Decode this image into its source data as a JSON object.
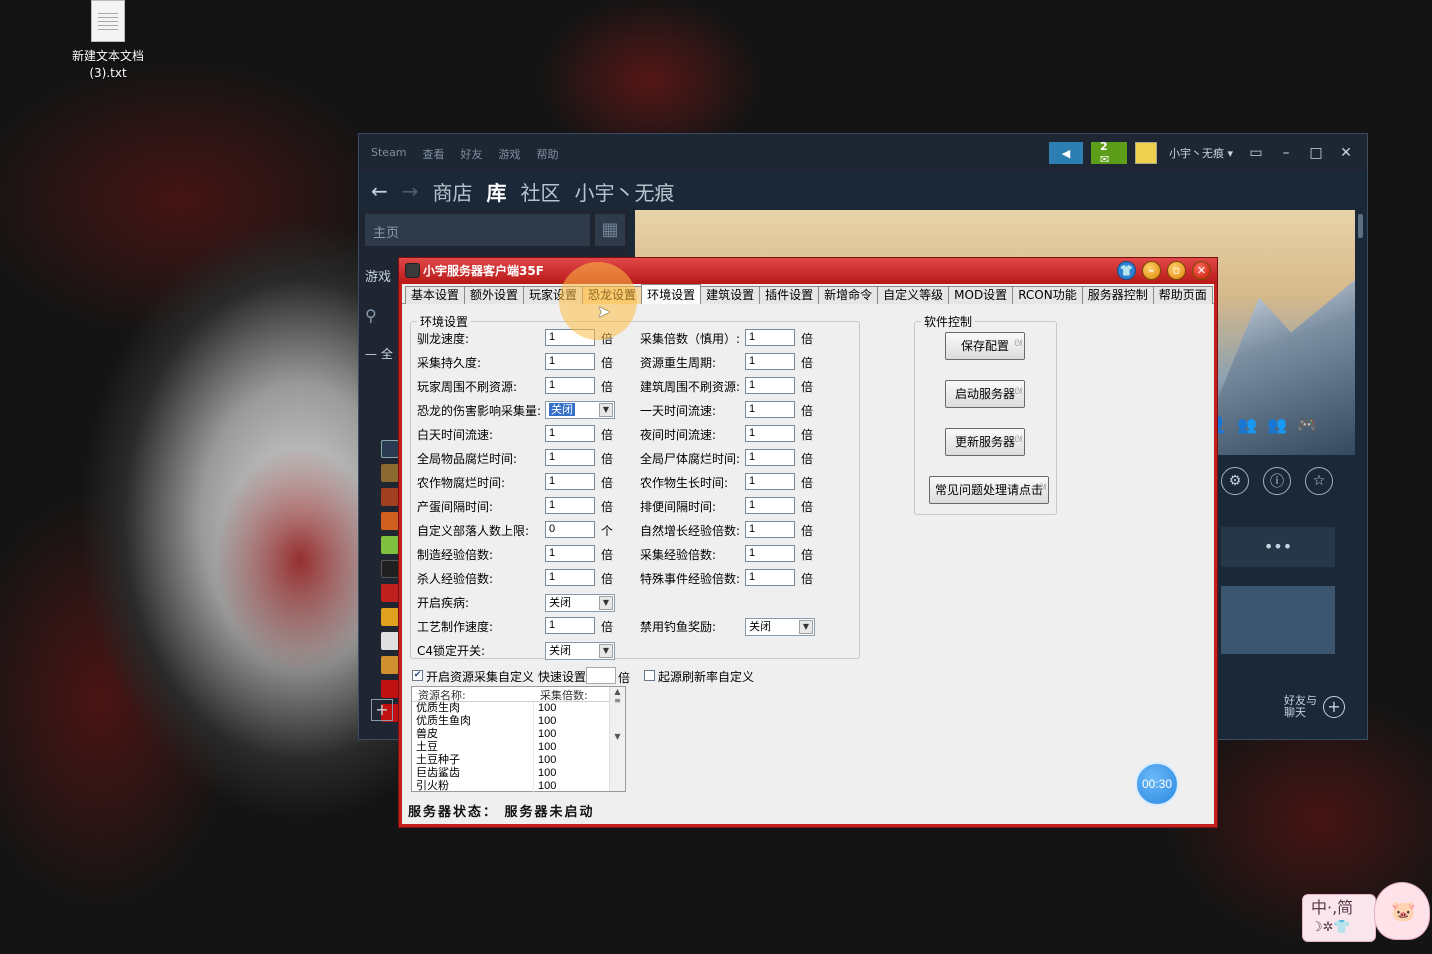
{
  "desktop": {
    "file_icon_label_1": "新建文本文档",
    "file_icon_label_2": "(3).txt"
  },
  "steam": {
    "menu": [
      "Steam",
      "查看",
      "好友",
      "游戏",
      "帮助"
    ],
    "notif_count": "2 ✉",
    "username": "小宇丶无痕 ▾",
    "nav": [
      "商店",
      "库",
      "社区",
      "小宇丶无痕"
    ],
    "sidebar_home": "主页",
    "sidebar_games": "游戏",
    "sidebar_all": "全",
    "chat_label_1": "好友与",
    "chat_label_2": "聊天",
    "more": "•••"
  },
  "app": {
    "title": "小宇服务器客户端35F",
    "tabs": [
      "基本设置",
      "额外设置",
      "玩家设置",
      "恐龙设置",
      "环境设置",
      "建筑设置",
      "插件设置",
      "新增命令",
      "自定义等级",
      "MOD设置",
      "RCON功能",
      "服务器控制",
      "帮助页面"
    ],
    "env_legend": "环境设置",
    "left_fields": [
      {
        "label": "驯龙速度:",
        "value": "1",
        "unit": "倍"
      },
      {
        "label": "采集持久度:",
        "value": "1",
        "unit": "倍"
      },
      {
        "label": "玩家周围不刷资源:",
        "value": "1",
        "unit": "倍"
      },
      {
        "label": "恐龙的伤害影响采集量:",
        "value": "关闭",
        "unit": ""
      },
      {
        "label": "白天时间流速:",
        "value": "1",
        "unit": "倍"
      },
      {
        "label": "全局物品腐烂时间:",
        "value": "1",
        "unit": "倍"
      },
      {
        "label": "农作物腐烂时间:",
        "value": "1",
        "unit": "倍"
      },
      {
        "label": "产蛋间隔时间:",
        "value": "1",
        "unit": "倍"
      },
      {
        "label": "自定义部落人数上限:",
        "value": "0",
        "unit": "个"
      },
      {
        "label": "制造经验倍数:",
        "value": "1",
        "unit": "倍"
      },
      {
        "label": "杀人经验倍数:",
        "value": "1",
        "unit": "倍"
      },
      {
        "label": "开启疾病:",
        "value": "关闭",
        "unit": ""
      },
      {
        "label": "工艺制作速度:",
        "value": "1",
        "unit": "倍"
      },
      {
        "label": "C4锁定开关:",
        "value": "关闭",
        "unit": ""
      }
    ],
    "right_fields": [
      {
        "label": "采集倍数（慎用）:",
        "value": "1",
        "unit": "倍"
      },
      {
        "label": "资源重生周期:",
        "value": "1",
        "unit": "倍"
      },
      {
        "label": "建筑周围不刷资源:",
        "value": "1",
        "unit": "倍"
      },
      {
        "label": "一天时间流速:",
        "value": "1",
        "unit": "倍"
      },
      {
        "label": "夜间时间流速:",
        "value": "1",
        "unit": "倍"
      },
      {
        "label": "全局尸体腐烂时间:",
        "value": "1",
        "unit": "倍"
      },
      {
        "label": "农作物生长时间:",
        "value": "1",
        "unit": "倍"
      },
      {
        "label": "排便间隔时间:",
        "value": "1",
        "unit": "倍"
      },
      {
        "label": "自然增长经验倍数:",
        "value": "1",
        "unit": "倍"
      },
      {
        "label": "采集经验倍数:",
        "value": "1",
        "unit": "倍"
      },
      {
        "label": "特殊事件经验倍数:",
        "value": "1",
        "unit": "倍"
      },
      {
        "label": "禁用钓鱼奖励:",
        "value": "关闭",
        "unit": ""
      }
    ],
    "ctrl_legend": "软件控制",
    "ctrl_buttons": [
      "保存配置",
      "启动服务器",
      "更新服务器",
      "常见问题处理请点击"
    ],
    "resource_toggle": "开启资源采集自定义",
    "quick_set": "快速设置",
    "quick_unit": "倍",
    "respawn_toggle": "起源刷新率自定义",
    "resource_headers": [
      "资源名称:",
      "采集倍数:"
    ],
    "resources": [
      {
        "name": "优质生肉",
        "value": "100"
      },
      {
        "name": "优质生鱼肉",
        "value": "100"
      },
      {
        "name": "兽皮",
        "value": "100"
      },
      {
        "name": "土豆",
        "value": "100"
      },
      {
        "name": "土豆种子",
        "value": "100"
      },
      {
        "name": "巨齿鲨齿",
        "value": "100"
      },
      {
        "name": "引火粉",
        "value": "100"
      }
    ],
    "status": "服务器状态：  服务器未启动"
  },
  "overlay": {
    "timer": "00:30",
    "ime_line_1": "中·,简",
    "ime_line_2": "☽✲👕"
  }
}
